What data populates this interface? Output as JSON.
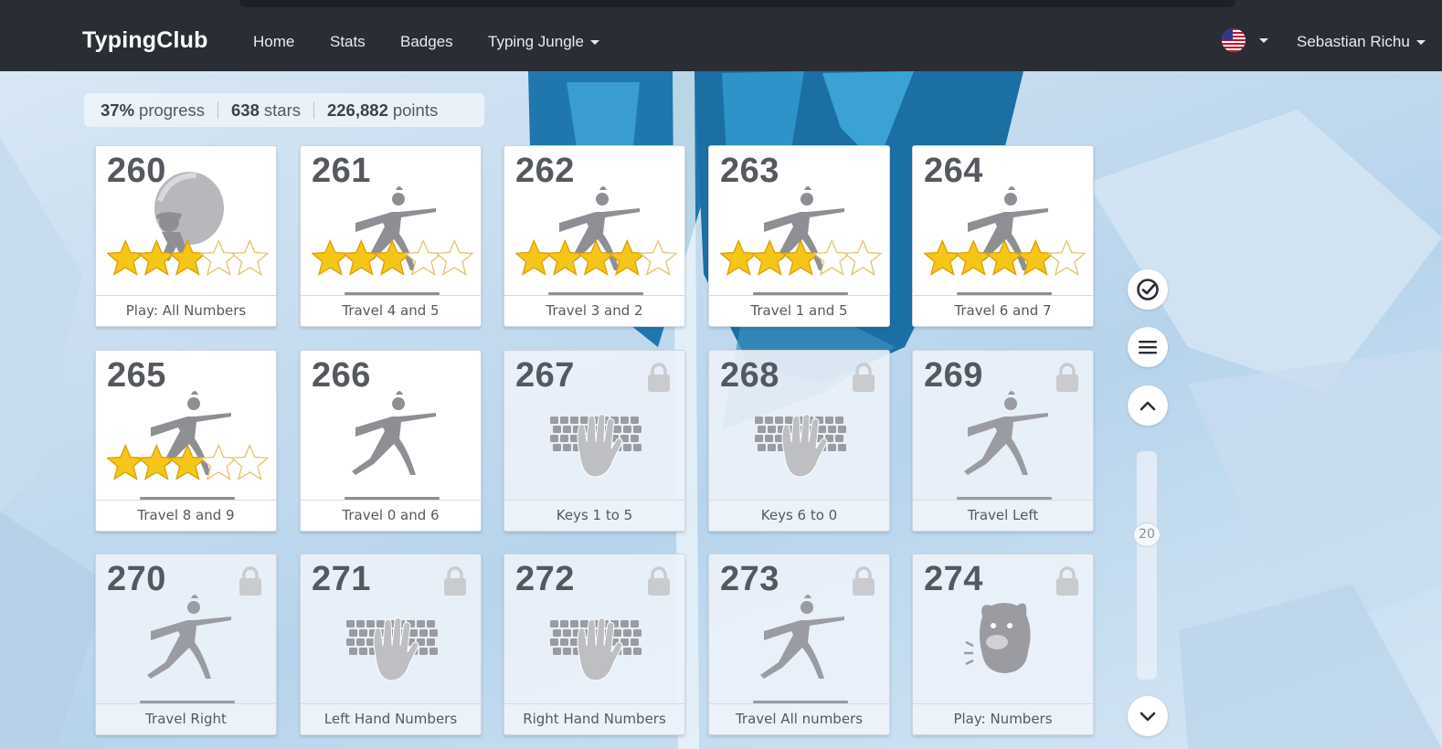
{
  "app": {
    "logo": "TypingClub"
  },
  "nav": {
    "home": "Home",
    "stats": "Stats",
    "badges": "Badges",
    "jungle": "Typing Jungle",
    "user": "Sebastian Richu"
  },
  "progress": {
    "percent": "37%",
    "percent_label": "progress",
    "stars": "638",
    "stars_label": "stars",
    "points": "226,882",
    "points_label": "points"
  },
  "lessons": [
    {
      "num": "260",
      "title": "Play: All Numbers",
      "icon": "balloon-ninja-icon",
      "stars": 3,
      "locked": false
    },
    {
      "num": "261",
      "title": "Travel 4 and 5",
      "icon": "lunge-figure-icon",
      "stars": 3,
      "locked": false
    },
    {
      "num": "262",
      "title": "Travel 3 and 2",
      "icon": "lunge-figure-icon",
      "stars": 4,
      "locked": false
    },
    {
      "num": "263",
      "title": "Travel 1 and 5",
      "icon": "lunge-figure-icon",
      "stars": 3,
      "locked": false
    },
    {
      "num": "264",
      "title": "Travel 6 and 7",
      "icon": "lunge-figure-icon",
      "stars": 4,
      "locked": false
    },
    {
      "num": "265",
      "title": "Travel 8 and 9",
      "icon": "lunge-figure-icon",
      "stars": 3,
      "locked": false
    },
    {
      "num": "266",
      "title": "Travel 0 and 6",
      "icon": "lunge-figure-icon",
      "stars": 0,
      "locked": false
    },
    {
      "num": "267",
      "title": "Keys 1 to 5",
      "icon": "keyboard-hand-icon",
      "stars": 0,
      "locked": true
    },
    {
      "num": "268",
      "title": "Keys 6 to 0",
      "icon": "keyboard-hand-icon",
      "stars": 0,
      "locked": true
    },
    {
      "num": "269",
      "title": "Travel Left",
      "icon": "lunge-figure-icon",
      "stars": 0,
      "locked": true
    },
    {
      "num": "270",
      "title": "Travel Right",
      "icon": "lunge-figure-icon",
      "stars": 0,
      "locked": true
    },
    {
      "num": "271",
      "title": "Left Hand Numbers",
      "icon": "keyboard-hand-icon",
      "stars": 0,
      "locked": true
    },
    {
      "num": "272",
      "title": "Right Hand Numbers",
      "icon": "keyboard-hand-icon",
      "stars": 0,
      "locked": true
    },
    {
      "num": "273",
      "title": "Travel All numbers",
      "icon": "lunge-figure-icon",
      "stars": 0,
      "locked": true
    },
    {
      "num": "274",
      "title": "Play: Numbers",
      "icon": "monster-icon",
      "stars": 0,
      "locked": true
    }
  ],
  "sidebar": {
    "check_icon": "check-circle-icon",
    "menu_icon": "hamburger-menu-icon",
    "up_icon": "chevron-up-icon",
    "down_icon": "chevron-down-icon",
    "scroll_value": "20"
  },
  "colors": {
    "navbar": "#2a2d34",
    "star_fill": "#f5c518",
    "icon_gray": "#8d8f94",
    "text": "#57595d"
  }
}
